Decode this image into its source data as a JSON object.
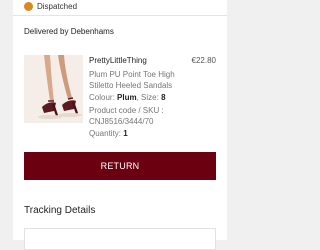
{
  "status": {
    "text": "Dispatched",
    "dot_color": "#d98a1e"
  },
  "delivery": {
    "label": "Delivered by Debenhams"
  },
  "item": {
    "brand": "PrettyLittleThing",
    "price": "€22.80",
    "name": "Plum PU Point Toe High Stiletto Heeled Sandals",
    "colour_label": "Colour:",
    "colour_value": "Plum",
    "size_label": "Size:",
    "size_value": "8",
    "sku_label": "Product code / SKU :",
    "sku_value": "CNJ8516/3444/70",
    "quantity_label": "Quantity:",
    "quantity_value": "1",
    "image_icon": "product-photo-sandals"
  },
  "actions": {
    "return_label": "RETURN",
    "return_color": "#6b0010"
  },
  "tracking": {
    "title": "Tracking Details"
  }
}
